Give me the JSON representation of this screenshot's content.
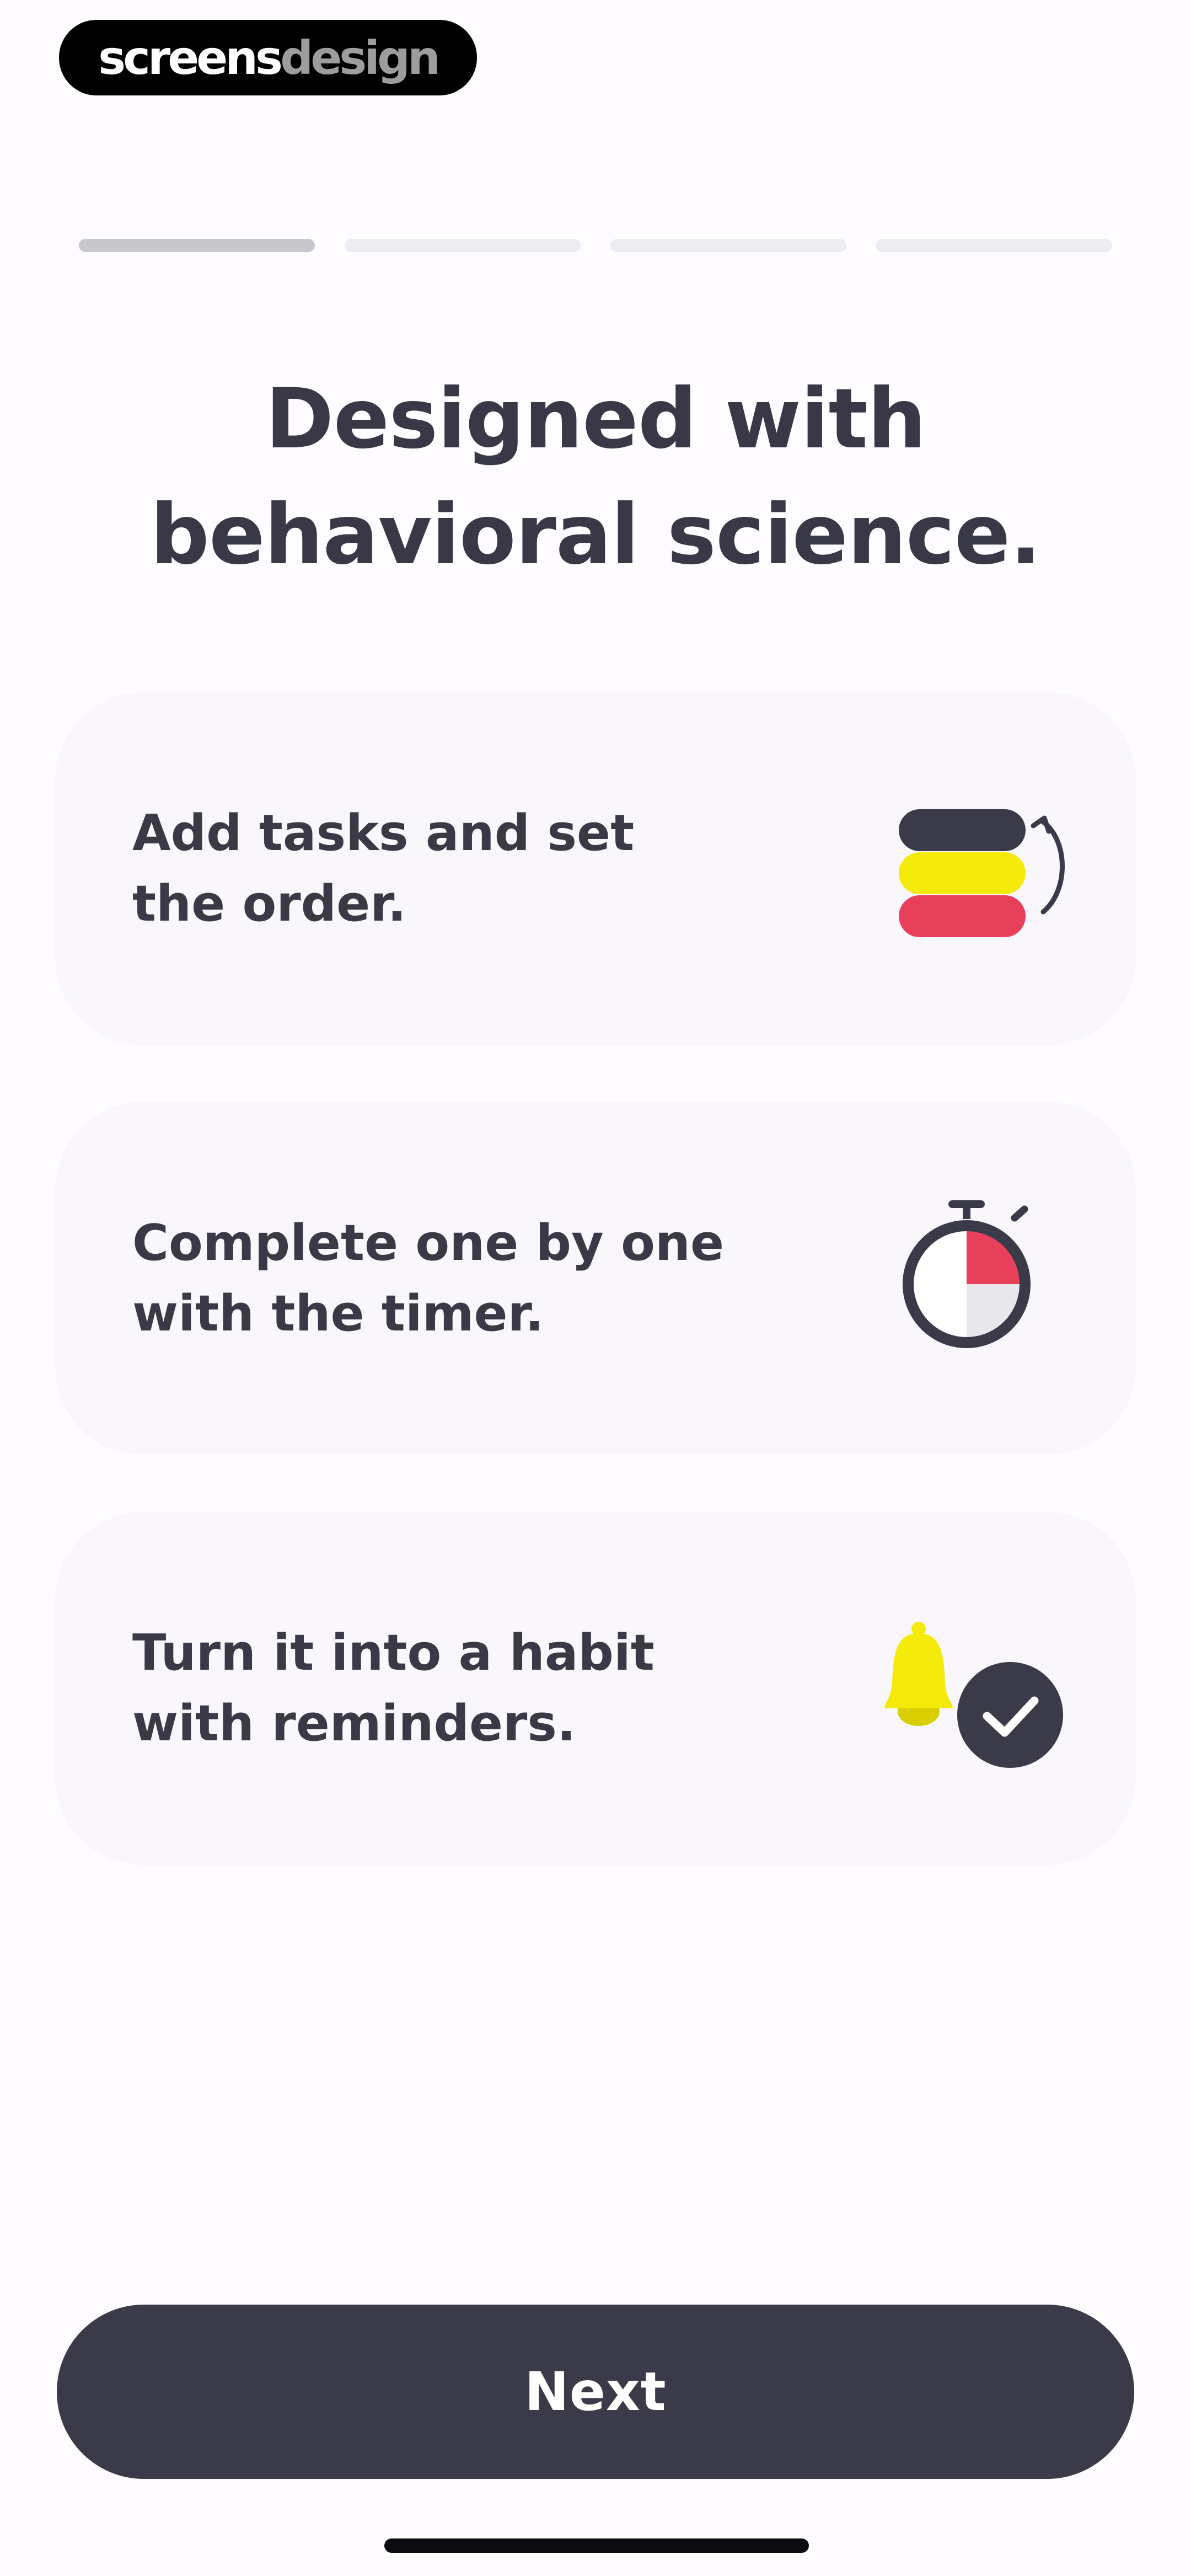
{
  "brand": {
    "part1": "screens",
    "part2": "design"
  },
  "progress": {
    "total_steps": 4,
    "current_step": 1
  },
  "title": {
    "line1": "Designed with",
    "line2": "behavioral science."
  },
  "features": [
    {
      "line1": "Add tasks and set",
      "line2": "the order.",
      "icon": "task-order-icon"
    },
    {
      "line1": "Complete one by one",
      "line2": "with the timer.",
      "icon": "stopwatch-icon"
    },
    {
      "line1": "Turn it into a habit",
      "line2": "with reminders.",
      "icon": "bell-check-icon"
    }
  ],
  "next_button": {
    "label": "Next"
  },
  "colors": {
    "dark": "#3b3a48",
    "yellow": "#f5eb0a",
    "red": "#e8405a",
    "card_bg": "#f9f7fb",
    "page_bg": "#fefcfe"
  }
}
